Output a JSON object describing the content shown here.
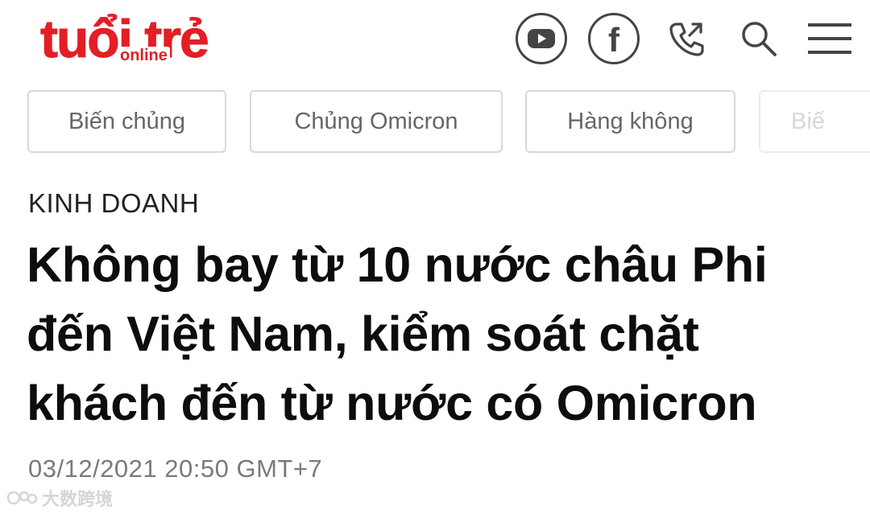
{
  "logo": {
    "main": "tuổi trẻ",
    "sub": "online"
  },
  "header_icons": [
    {
      "name": "youtube-icon"
    },
    {
      "name": "facebook-icon",
      "glyph": "f"
    },
    {
      "name": "phone-icon"
    },
    {
      "name": "search-icon"
    },
    {
      "name": "menu-icon"
    }
  ],
  "tags": [
    {
      "label": "Biến chủng"
    },
    {
      "label": "Chủng Omicron"
    },
    {
      "label": "Hàng không"
    },
    {
      "label": "Biế"
    }
  ],
  "article": {
    "category": "KINH DOANH",
    "title": "Không bay từ 10 nước châu Phi đến Việt Nam, kiểm soát chặt khách đến từ nước có Omicron",
    "timestamp": "03/12/2021 20:50 GMT+7"
  },
  "watermark": {
    "text": "大数跨境"
  },
  "colors": {
    "brand_red": "#e31e24",
    "icon_gray": "#444444",
    "chip_border": "#d8d8d8",
    "chip_text": "#666666",
    "timestamp": "#7a7a7a"
  }
}
